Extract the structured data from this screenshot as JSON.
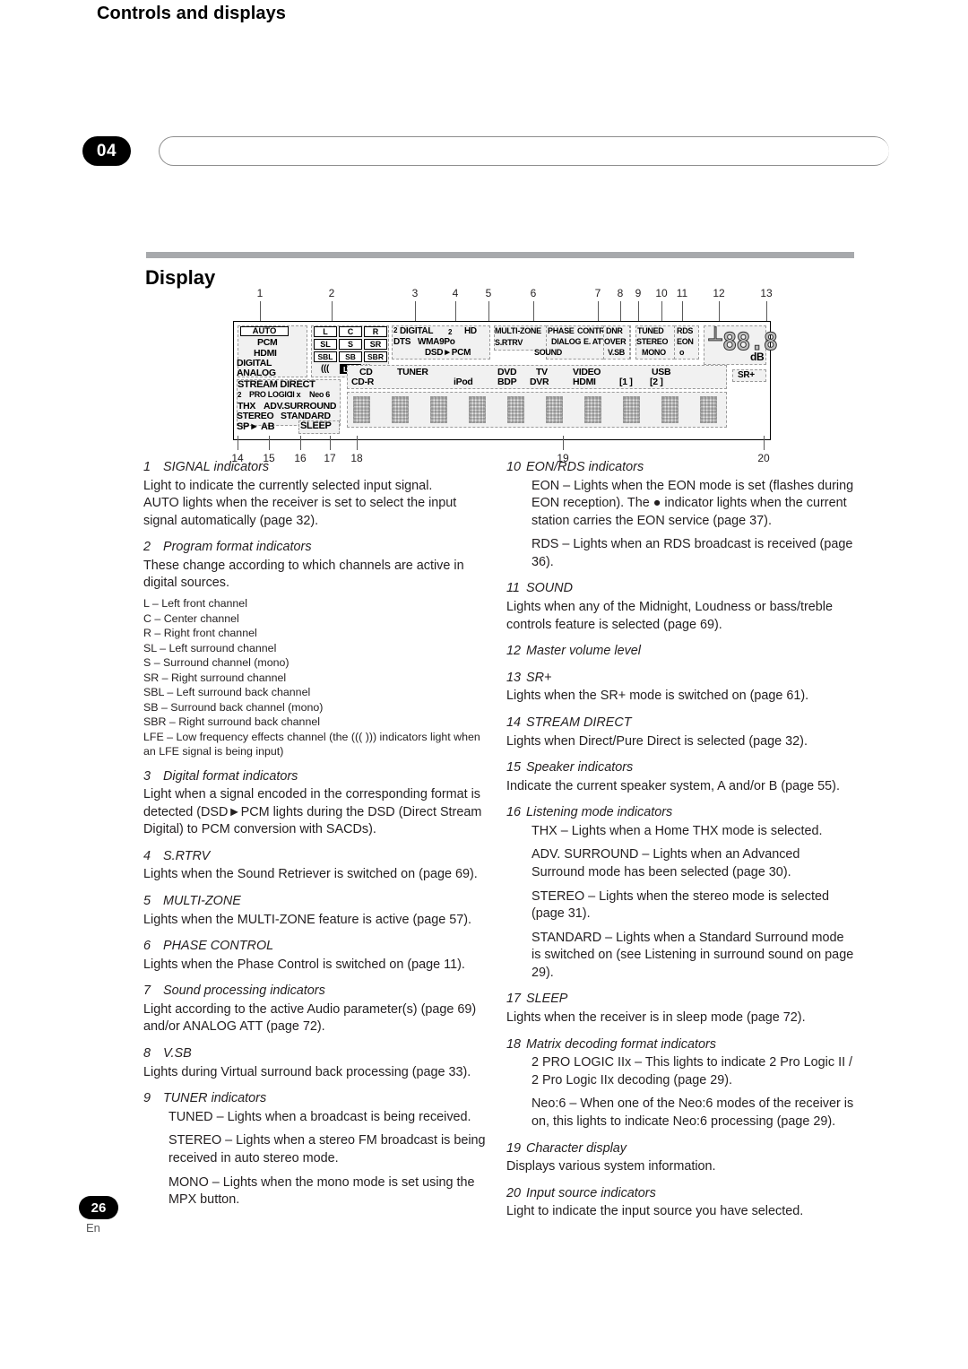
{
  "header": {
    "chapter_number": "04",
    "title": "Controls and displays"
  },
  "section": {
    "title": "Display"
  },
  "figure": {
    "callouts_top": [
      "1",
      "2",
      "3",
      "4",
      "5",
      "6",
      "7",
      "8",
      "9",
      "10",
      "11",
      "12",
      "13"
    ],
    "callouts_bottom": [
      "14",
      "15",
      "16",
      "17",
      "18",
      "19",
      "20"
    ],
    "signal_indicators": [
      "AUTO",
      "PCM",
      "HDMI",
      "DIGITAL",
      "ANALOG"
    ],
    "program_format": {
      "row1": [
        "L",
        "C",
        "R"
      ],
      "row2": [
        "SL",
        "S",
        "SR"
      ],
      "row3": [
        "SBL",
        "SB",
        "SBR"
      ],
      "lfe_left": "(((",
      "lfe": "LFE",
      "lfe_right": ")))"
    },
    "digital_format": {
      "dd_prefix": "2",
      "dd": "DIGITAL",
      "dd_suffix": "2",
      "hd": "HD",
      "dts": "DTS",
      "wma": "WMA9Pᴏ",
      "dsd": "DSD►PCM"
    },
    "multizone": "MULTI-ZONE",
    "srtrv": "S.RTRV",
    "phase_control": "PHASE CONTROL",
    "sound_processing": [
      "DIALOG",
      "E. ATT",
      "SOUND",
      "DNR",
      "OVER",
      "V.SB"
    ],
    "tuner": [
      "TUNED",
      "STEREO",
      "MONO"
    ],
    "rds": [
      "RDS",
      "EON",
      "o"
    ],
    "volume": {
      "digits": "88.8",
      "unit": "dB"
    },
    "sr_plus": "SR+",
    "stream_direct": "STREAM DIRECT",
    "matrix_decoding": {
      "dd2": "2",
      "prologic": "PRO LOGIC",
      "iix": "II x",
      "neo": "Neo 6"
    },
    "listening_modes": [
      "THX",
      "ADV.SURROUND",
      "STEREO",
      "STANDARD"
    ],
    "speaker": "SP► AB",
    "sleep": "SLEEP",
    "input_sources_row1": [
      "CD",
      "TUNER",
      "DVD",
      "TV",
      "VIDEO",
      "USB"
    ],
    "input_sources_row2": [
      "CD-R",
      "iPod",
      "BDP",
      "DVR",
      "HDMI",
      "[1 ]",
      "[2 ]"
    ]
  },
  "left_column": [
    {
      "num": "1",
      "head": "SIGNAL  indicators",
      "paras": [
        "Light to indicate the currently selected input signal.",
        "AUTO  lights when the receiver is set to select the input signal automatically (page 32)."
      ]
    },
    {
      "num": "2",
      "head": "Program format indicators",
      "paras": [
        "These change according to which channels are active in digital sources."
      ],
      "channel_list": [
        "L – Left front channel",
        "C – Center channel",
        "R – Right front channel",
        "SL – Left surround channel",
        "S – Surround channel (mono)",
        "SR – Right surround channel",
        "SBL – Left surround back channel",
        "SB – Surround back channel (mono)",
        "SBR – Right surround back channel",
        "LFE – Low frequency effects channel (the ((( ))) indicators light when an LFE signal is being input)"
      ]
    },
    {
      "num": "3",
      "head": "Digital format indicators",
      "paras": [
        "Light when a signal encoded in the corresponding format is detected (DSD►PCM lights during the DSD (Direct Stream Digital) to PCM conversion with SACDs)."
      ]
    },
    {
      "num": "4",
      "head": "S.RTRV",
      "paras": [
        "Lights when the Sound Retriever is switched on (page 69)."
      ]
    },
    {
      "num": "5",
      "head": "MULTI-ZONE",
      "paras": [
        "Lights when the MULTI-ZONE feature is active (page 57)."
      ]
    },
    {
      "num": "6",
      "head": "PHASE CONTROL",
      "paras": [
        "Lights when the Phase Control is switched on (page 11)."
      ]
    },
    {
      "num": "7",
      "head": "Sound processing indicators",
      "paras": [
        "Light according to the active Audio parameter(s) (page 69) and/or ANALOG ATT   (page 72)."
      ]
    },
    {
      "num": "8",
      "head": "V.SB",
      "paras": [
        "Lights during Virtual surround back processing (page 33)."
      ]
    },
    {
      "num": "9",
      "head": "TUNER indicators",
      "subs": [
        "TUNED – Lights when a broadcast is being received.",
        "STEREO  – Lights when a stereo FM broadcast is being received in auto stereo mode.",
        "MONO  – Lights when the mono mode is set using the MPX  button."
      ]
    }
  ],
  "right_column": [
    {
      "num": "10",
      "head": "EON/RDS indicators",
      "subs": [
        "EON – Lights when the EON mode is set (flashes during EON reception). The ● indicator lights when the current station carries the EON service (page 37).",
        "RDS – Lights when an RDS broadcast is received (page 36)."
      ]
    },
    {
      "num": "11",
      "head": "SOUND",
      "paras": [
        "Lights when any of the Midnight, Loudness or bass/treble controls feature is selected (page 69)."
      ]
    },
    {
      "num": "12",
      "head": "Master volume level",
      "paras": []
    },
    {
      "num": "13",
      "head": "SR+",
      "paras": [
        "Lights when the SR+  mode is switched on (page 61)."
      ]
    },
    {
      "num": "14",
      "head": "STREAM DIRECT",
      "paras": [
        "Lights when Direct/Pure Direct is selected (page 32)."
      ]
    },
    {
      "num": "15",
      "head": "Speaker indicators",
      "paras": [
        "Indicate the current speaker system, A and/or B (page 55)."
      ]
    },
    {
      "num": "16",
      "head": "Listening mode indicators",
      "subs": [
        "THX  – Lights when a Home THX mode is selected.",
        "ADV. SURROUND   – Lights when an Advanced Surround mode has been selected (page 30).",
        "STEREO  – Lights when the stereo mode is selected (page 31).",
        "STANDARD  – Lights when a Standard Surround mode is switched on (see Listening in surround sound on page 29)."
      ]
    },
    {
      "num": "17",
      "head": "SLEEP",
      "paras": [
        "Lights when the receiver is in sleep mode (page 72)."
      ]
    },
    {
      "num": "18",
      "head": "Matrix decoding format indicators",
      "subs": [
        "2 PRO LOGIC IIx  – This lights to indicate 2  Pro Logic II / 2  Pro Logic IIx decoding (page 29).",
        "Neo:6 – When one of the Neo:6 modes of the receiver is on, this lights to indicate Neo:6 processing (page 29)."
      ]
    },
    {
      "num": "19",
      "head": "Character display",
      "paras": [
        "Displays various system information."
      ]
    },
    {
      "num": "20",
      "head": "Input source indicators",
      "paras": [
        "Light to indicate the input source you have selected."
      ]
    }
  ],
  "footer": {
    "page_number": "26",
    "language": "En"
  }
}
